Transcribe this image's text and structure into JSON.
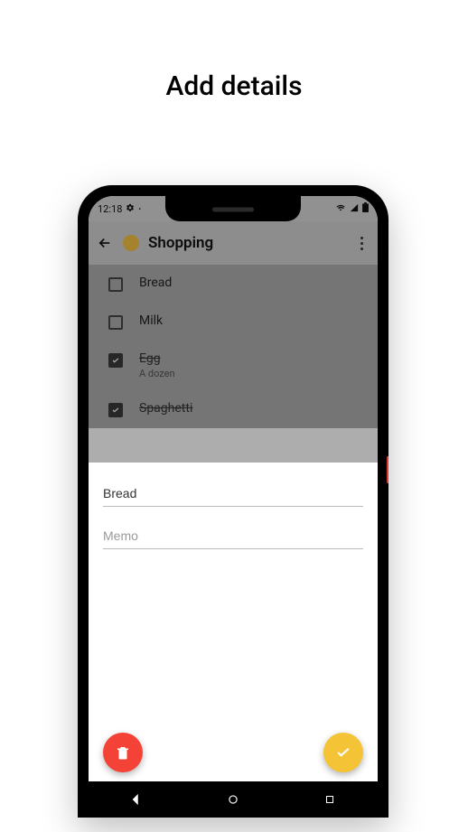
{
  "page_title": "Add details",
  "statusbar": {
    "time": "12:18"
  },
  "toolbar": {
    "title": "Shopping",
    "dot_color": "#f4c244"
  },
  "list": {
    "items": [
      {
        "label": "Bread",
        "checked": false,
        "sub": ""
      },
      {
        "label": "Milk",
        "checked": false,
        "sub": ""
      },
      {
        "label": "Egg",
        "checked": true,
        "sub": "A dozen"
      },
      {
        "label": "Spaghetti",
        "checked": true,
        "sub": ""
      }
    ]
  },
  "sheet": {
    "name_value": "Bread",
    "memo_placeholder": "Memo"
  },
  "colors": {
    "delete_fab": "#f44336",
    "confirm_fab": "#f4c336"
  }
}
